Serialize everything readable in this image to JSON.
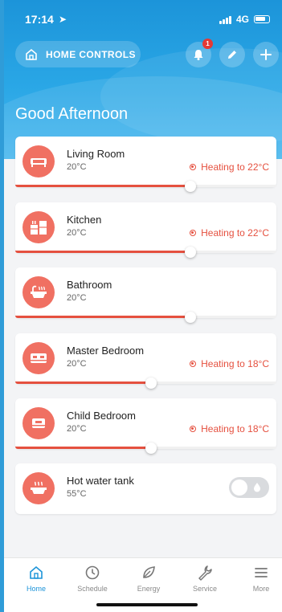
{
  "status_bar": {
    "time": "17:14",
    "network": "4G"
  },
  "header": {
    "home_controls_label": "HOME CONTROLS",
    "notification_count": "1",
    "greeting": "Good Afternoon"
  },
  "rooms": [
    {
      "name": "Living Room",
      "temp": "20°C",
      "status": "Heating to 22°C",
      "level": 0.67
    },
    {
      "name": "Kitchen",
      "temp": "20°C",
      "status": "Heating to 22°C",
      "level": 0.67
    },
    {
      "name": "Bathroom",
      "temp": "20°C",
      "status": "",
      "level": 0.67
    },
    {
      "name": "Master Bedroom",
      "temp": "20°C",
      "status": "Heating to 18°C",
      "level": 0.52
    },
    {
      "name": "Child Bedroom",
      "temp": "20°C",
      "status": "Heating to 18°C",
      "level": 0.52
    },
    {
      "name": "Hot water tank",
      "temp": "55°C",
      "status": "",
      "toggle_on": false
    }
  ],
  "tabs": [
    {
      "label": "Home",
      "icon": "home-icon",
      "active": true
    },
    {
      "label": "Schedule",
      "icon": "clock-icon",
      "active": false
    },
    {
      "label": "Energy",
      "icon": "leaf-icon",
      "active": false
    },
    {
      "label": "Service",
      "icon": "wrench-icon",
      "active": false
    },
    {
      "label": "More",
      "icon": "menu-icon",
      "active": false
    }
  ],
  "colors": {
    "accent": "#1c94d9",
    "heating": "#e5503f",
    "room_icon": "#f07062"
  }
}
